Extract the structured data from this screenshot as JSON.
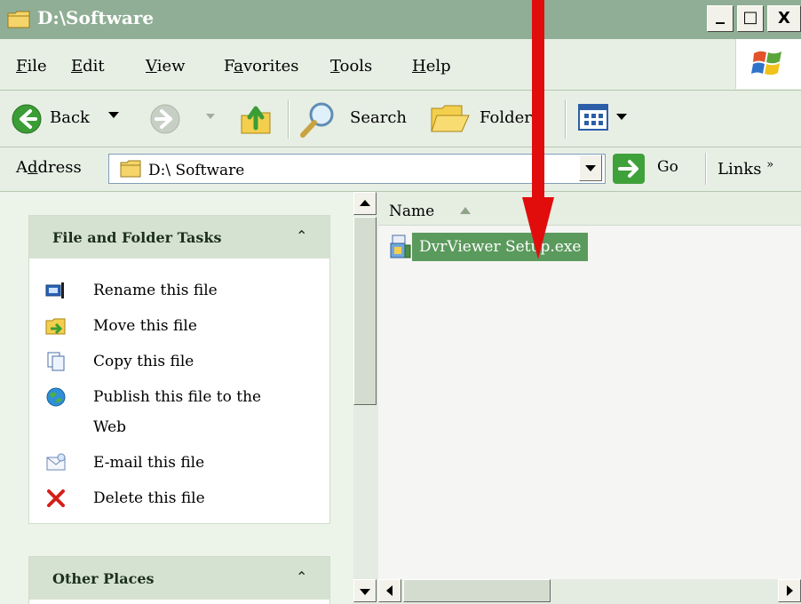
{
  "window": {
    "title": "D:\\Software",
    "minimize_glyph": "_",
    "maximize_glyph": "□",
    "close_glyph": "X"
  },
  "menu": [
    {
      "pre": "",
      "key": "F",
      "post": "ile"
    },
    {
      "pre": "",
      "key": "E",
      "post": "dit"
    },
    {
      "pre": "",
      "key": "V",
      "post": "iew"
    },
    {
      "pre": "F",
      "key": "a",
      "post": "vorites"
    },
    {
      "pre": "",
      "key": "T",
      "post": "ools"
    },
    {
      "pre": "",
      "key": "H",
      "post": "elp"
    }
  ],
  "toolbar": {
    "back_label": "Back",
    "search_label": "Search",
    "folders_label": "Folder"
  },
  "address": {
    "label_pre": "A",
    "label_key": "d",
    "label_post": "dress",
    "value": "D:\\ Software",
    "go_label": "Go",
    "links_label": "Links",
    "links_chevron": "»"
  },
  "tasks": {
    "header": "File and Folder Tasks",
    "collapse_glyph": "⌃",
    "items": [
      {
        "label": "Rename this file",
        "icon": "rename-icon"
      },
      {
        "label": "Move this file",
        "icon": "move-icon"
      },
      {
        "label": "Copy this file",
        "icon": "copy-icon"
      },
      {
        "label": "Publish this file to the",
        "label2": "Web",
        "icon": "publish-web-icon"
      },
      {
        "label": "E-mail this file",
        "icon": "email-icon"
      },
      {
        "label": "Delete this file",
        "icon": "delete-icon"
      }
    ]
  },
  "other_places": {
    "header": "Other Places",
    "collapse_glyph": "⌃"
  },
  "filelist": {
    "column_name": "Name",
    "files": [
      {
        "name": "DvrViewer Setup.exe",
        "selected": true,
        "icon": "setup-exe-icon"
      }
    ]
  },
  "colors": {
    "title_bar": "#8fae95",
    "selection": "#5b9a5d",
    "annotation_arrow": "#e10d0d"
  }
}
